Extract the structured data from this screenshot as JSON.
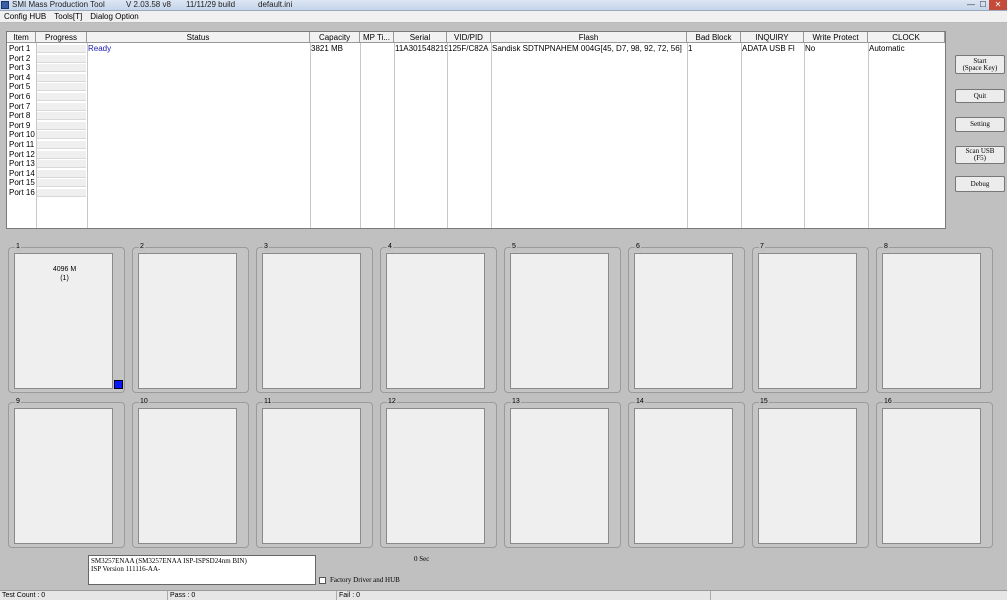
{
  "window": {
    "title": "SMI Mass Production Tool",
    "version": "V 2.03.58  v8",
    "build": "11/11/29 build",
    "ini": "default.ini",
    "controls": [
      "—",
      "☐",
      "✕"
    ]
  },
  "menu": [
    "Config HUB",
    "Tools[T]",
    "Dialog Option"
  ],
  "grid": {
    "columns": [
      "Item",
      "Progress",
      "Status",
      "Capacity",
      "MP Ti...",
      "Serial",
      "VID/PID",
      "Flash",
      "Bad Block",
      "INQUIRY",
      "Write Protect",
      "CLOCK"
    ],
    "ports": [
      "Port 1",
      "Port 2",
      "Port 3",
      "Port 4",
      "Port 5",
      "Port 6",
      "Port 7",
      "Port 8",
      "Port 9",
      "Port 10",
      "Port 11",
      "Port 12",
      "Port 13",
      "Port 14",
      "Port 15",
      "Port 16"
    ],
    "row1": {
      "status": "Ready",
      "capacity": "3821 MB",
      "serial": "11A301548219",
      "vidpid": "125F/C82A",
      "flash": "Sandisk SDTNPNAHEM 004G[45, D7, 98, 92, 72, 56]",
      "bad_block": "1",
      "inquiry": "ADATA  USB Fl",
      "write_protect": "No",
      "clock": "Automatic"
    }
  },
  "buttons": {
    "start": "Start\n(Space Key)",
    "quit": "Quit",
    "setting": "Setting",
    "scan_usb": "Scan USB\n(F5)",
    "debug": "Debug"
  },
  "slots": [
    {
      "num": "1",
      "line1": "4096 M",
      "line2": "(1)",
      "active": true
    },
    {
      "num": "2"
    },
    {
      "num": "3"
    },
    {
      "num": "4"
    },
    {
      "num": "5"
    },
    {
      "num": "6"
    },
    {
      "num": "7"
    },
    {
      "num": "8"
    },
    {
      "num": "9"
    },
    {
      "num": "10"
    },
    {
      "num": "11"
    },
    {
      "num": "12"
    },
    {
      "num": "13"
    },
    {
      "num": "14"
    },
    {
      "num": "15"
    },
    {
      "num": "16"
    }
  ],
  "info": {
    "line1": "SM3257ENAA      (SM3257ENAA ISP-ISPSD24nm BIN)",
    "line2": "ISP Version          111116-AA-"
  },
  "timer": "0 Sec",
  "factory_driver_label": "Factory Driver and HUB",
  "status_bar": {
    "test_count": "Test Count : 0",
    "pass": "Pass : 0",
    "fail": "Fail : 0"
  },
  "colors": {
    "slot_led": "#0a16ff",
    "ready_text": "#1a1ab0"
  }
}
